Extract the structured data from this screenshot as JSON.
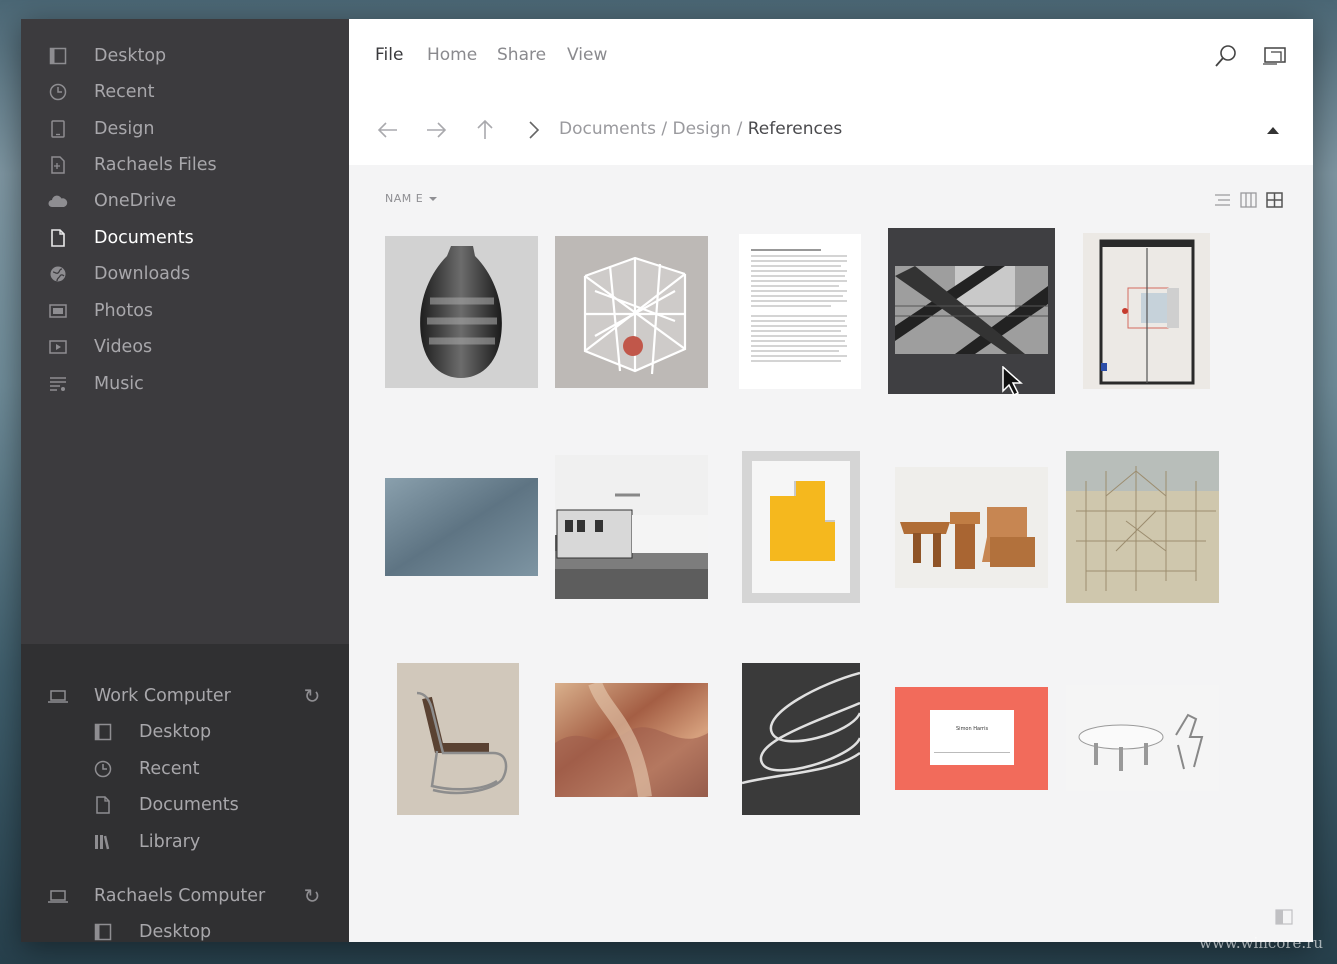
{
  "sidebar": {
    "items": [
      {
        "label": "Desktop",
        "icon": "desktop-icon"
      },
      {
        "label": "Recent",
        "icon": "clock-icon"
      },
      {
        "label": "Design",
        "icon": "tablet-icon"
      },
      {
        "label": "Rachaels Files",
        "icon": "shared-file-icon"
      },
      {
        "label": "OneDrive",
        "icon": "cloud-icon"
      },
      {
        "label": "Documents",
        "icon": "document-icon",
        "active": true
      },
      {
        "label": "Downloads",
        "icon": "globe-icon"
      },
      {
        "label": "Photos",
        "icon": "photos-icon"
      },
      {
        "label": "Videos",
        "icon": "video-icon"
      },
      {
        "label": "Music",
        "icon": "music-icon"
      }
    ],
    "computers": [
      {
        "name": "Work Computer",
        "icon": "laptop-icon",
        "children": [
          {
            "label": "Desktop",
            "icon": "desktop-icon"
          },
          {
            "label": "Recent",
            "icon": "clock-icon"
          },
          {
            "label": "Documents",
            "icon": "document-icon"
          },
          {
            "label": "Library",
            "icon": "library-icon"
          }
        ]
      },
      {
        "name": "Rachaels Computer",
        "icon": "laptop-icon",
        "children": [
          {
            "label": "Desktop",
            "icon": "desktop-icon"
          }
        ]
      }
    ]
  },
  "menu": [
    "File",
    "Home",
    "Share",
    "View"
  ],
  "breadcrumb": {
    "parts": [
      "Documents",
      "Design"
    ],
    "separator": "/",
    "current": "References"
  },
  "sort_label": "NAM E",
  "watermark": "www.wincore.ru",
  "colors": {
    "sidebar": "#3c3b3e",
    "sidebar_bottom": "#303032",
    "content": "#f4f4f5",
    "selection": "#3f3f42",
    "accent_card": "#f26b5b"
  },
  "thumbnails": [
    {
      "name": "vase"
    },
    {
      "name": "wire-cube"
    },
    {
      "name": "text-document"
    },
    {
      "name": "architecture-bw",
      "selected": true
    },
    {
      "name": "glass-door"
    },
    {
      "name": "blue-texture"
    },
    {
      "name": "trailer"
    },
    {
      "name": "yellow-relief"
    },
    {
      "name": "wooden-furniture"
    },
    {
      "name": "abstract-map"
    },
    {
      "name": "cantilever-chair"
    },
    {
      "name": "watercolor-canyon"
    },
    {
      "name": "light-spiral"
    },
    {
      "name": "business-card"
    },
    {
      "name": "white-furniture"
    }
  ],
  "business_card_name": "Simon Harris"
}
